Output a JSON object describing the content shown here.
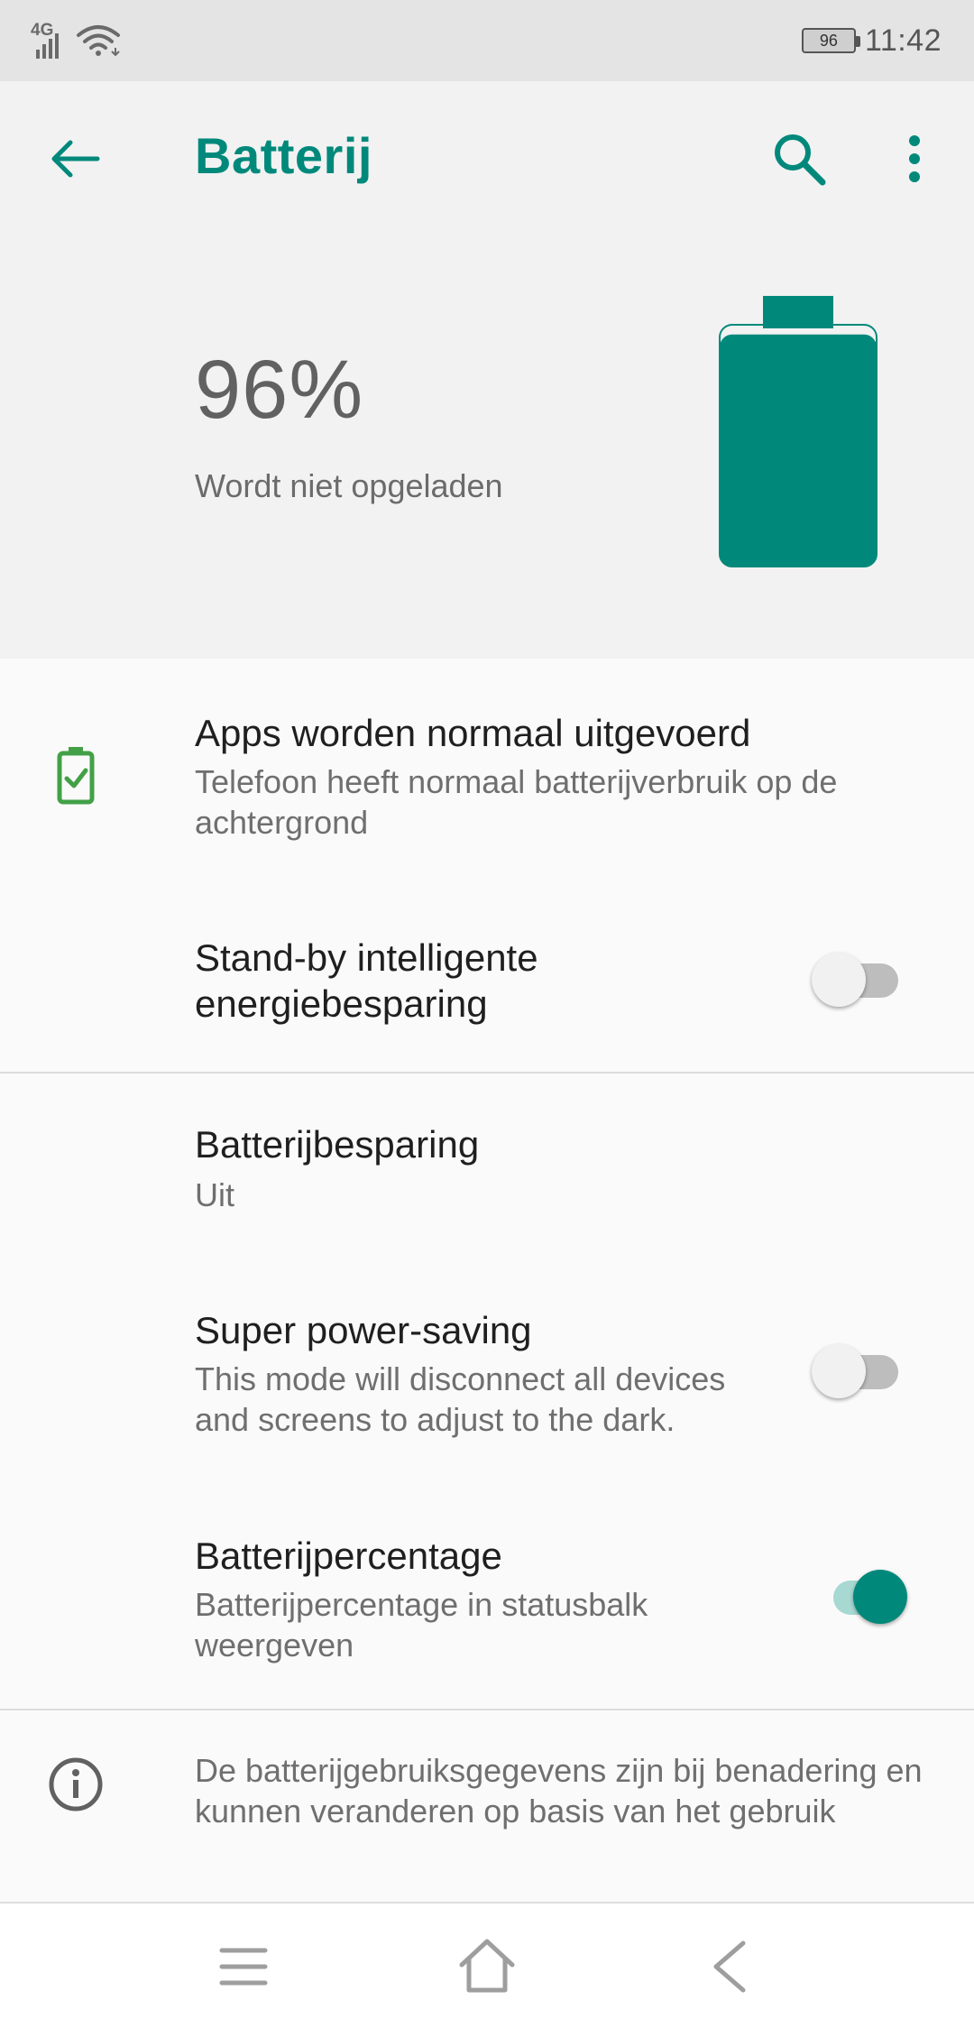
{
  "status_bar": {
    "network": "4G",
    "battery_level": "96",
    "time": "11:42"
  },
  "header": {
    "title": "Batterij",
    "icons": [
      "back-arrow-icon",
      "search-icon",
      "more-vert-icon"
    ]
  },
  "hero": {
    "percent": "96%",
    "status": "Wordt niet opgeladen",
    "battery_fill_fraction": 0.96,
    "accent_color": "#00897b"
  },
  "items": {
    "apps_normal": {
      "title": "Apps worden normaal uitgevoerd",
      "subtitle": "Telefoon heeft normaal batterijverbruik op de achtergrond",
      "icon": "battery-check-icon",
      "icon_color": "#43a047"
    },
    "standby": {
      "title": "Stand-by intelligente energiebesparing",
      "toggle_on": false
    },
    "saver": {
      "title": "Batterijbesparing",
      "subtitle": "Uit"
    },
    "super_saving": {
      "title": "Super power-saving",
      "subtitle": "This mode will disconnect all devices and screens to adjust to the dark.",
      "toggle_on": false
    },
    "percentage": {
      "title": "Batterijpercentage",
      "subtitle": "Batterijpercentage in statusbalk weergeven",
      "toggle_on": true
    }
  },
  "info": {
    "text": "De batterijgebruiksgegevens zijn bij benadering en kunnen veranderen op basis van het gebruik",
    "icon": "info-icon"
  },
  "nav": {
    "icons": [
      "menu-icon",
      "home-icon",
      "back-icon"
    ]
  }
}
